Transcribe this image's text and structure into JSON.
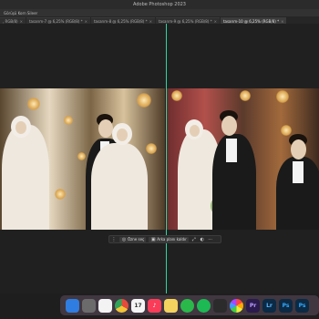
{
  "window": {
    "title": "Adobe Photoshop 2023"
  },
  "options_bar": {
    "text": "Görüşü Korn  Sileer"
  },
  "tabs": [
    {
      "label": ", RGB/8)",
      "active": false
    },
    {
      "label": "tasarım-7 @ 6,25% (RGB/8) *",
      "active": false
    },
    {
      "label": "tasarım-8 @ 6,25% (RGB/8) *",
      "active": false
    },
    {
      "label": "tasarım-9 @ 6,25% (RGB/8) *",
      "active": false
    },
    {
      "label": "tasarım-10 @ 6,25% (RGB/8) *",
      "active": true
    }
  ],
  "context_bar": {
    "select_subject": "Özne seç",
    "remove_background": "Arka planı kaldır"
  },
  "dock": [
    {
      "name": "finder-icon",
      "label": "",
      "color": "#2f7de1"
    },
    {
      "name": "launchpad-icon",
      "label": "",
      "color": "#6b6b6b"
    },
    {
      "name": "notes-icon",
      "label": "",
      "color": "#f3f3f3"
    },
    {
      "name": "chrome-icon",
      "label": "",
      "color": "#e2c04a"
    },
    {
      "name": "calendar-icon",
      "label": "17",
      "color": "#f5f5f5"
    },
    {
      "name": "music-icon",
      "label": "♪",
      "color": "#fa3c58"
    },
    {
      "name": "notes-yellow-icon",
      "label": "",
      "color": "#f4d35e"
    },
    {
      "name": "whatsapp-icon",
      "label": "",
      "color": "#2ab84b"
    },
    {
      "name": "spotify-icon",
      "label": "",
      "color": "#1db954"
    },
    {
      "name": "chatgpt-icon",
      "label": "",
      "color": "#2b2b2b"
    },
    {
      "name": "photos-icon",
      "label": "",
      "color": "#ffffff"
    },
    {
      "name": "premiere-icon",
      "label": "Pr",
      "color": "#2a1a4d"
    },
    {
      "name": "lightroom-icon",
      "label": "Lr",
      "color": "#0b2a45"
    },
    {
      "name": "photoshop-icon",
      "label": "Ps",
      "color": "#0d2a44"
    },
    {
      "name": "generic-icon",
      "label": "Ps",
      "color": "#0d2a44"
    }
  ]
}
